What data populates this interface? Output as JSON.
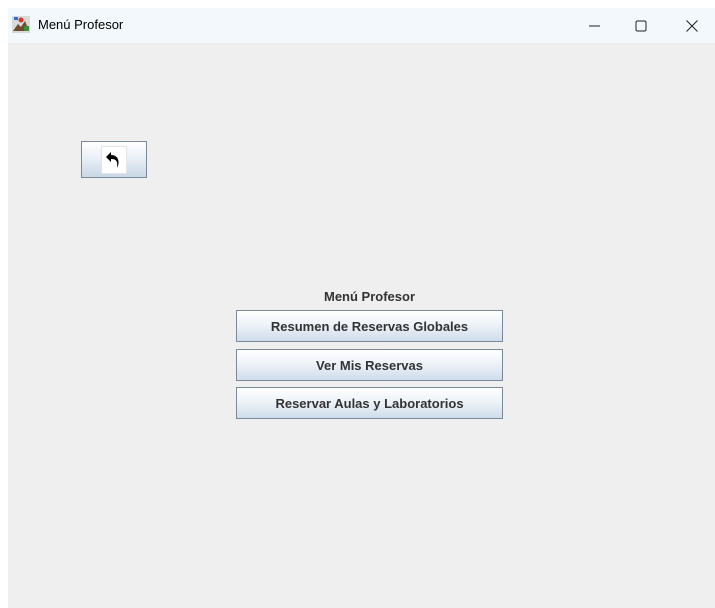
{
  "window": {
    "title": "Menú Profesor",
    "icons": {
      "app": "java-app-icon",
      "minimize": "minimize-icon",
      "maximize": "maximize-icon",
      "close": "close-icon"
    }
  },
  "back_button": {
    "icon": "undo-arrow-icon"
  },
  "menu": {
    "title": "Menú Profesor",
    "buttons": [
      "Resumen de Reservas Globales",
      "Ver Mis Reservas",
      "Reservar Aulas y Laboratorios"
    ]
  },
  "colors": {
    "titlebar": "#f2f8fb",
    "content_bg": "#efefef",
    "button_border": "#7a8a99",
    "button_text": "#333333"
  }
}
